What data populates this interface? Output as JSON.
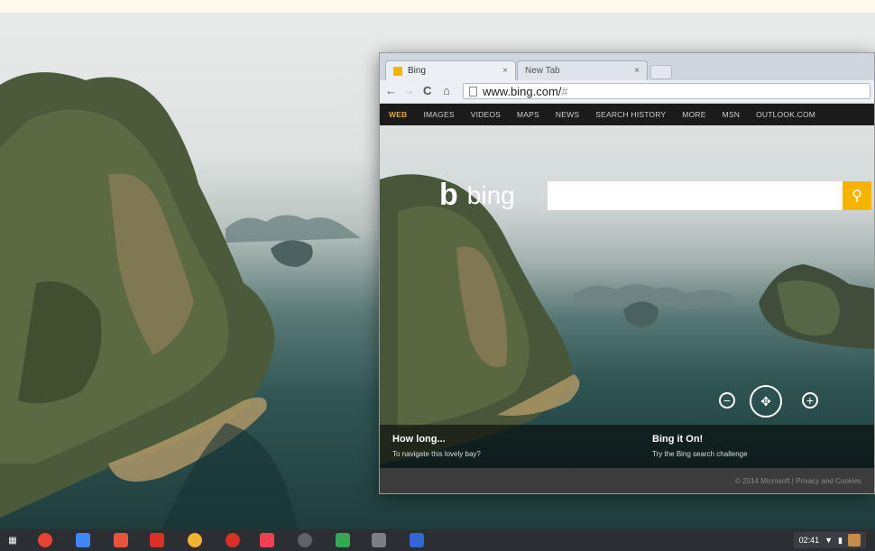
{
  "browser": {
    "tabs": [
      {
        "label": "Bing",
        "close": "×"
      },
      {
        "label": "New Tab",
        "close": "×"
      }
    ],
    "nav": {
      "back": "←",
      "forward": "→",
      "reload": "C",
      "home": "⌂"
    },
    "url": {
      "host": "www.bing.com/",
      "hash": "#"
    }
  },
  "bing": {
    "nav_items": [
      "WEB",
      "IMAGES",
      "VIDEOS",
      "MAPS",
      "NEWS",
      "SEARCH HISTORY",
      "MORE",
      "MSN",
      "OUTLOOK.COM"
    ],
    "logo_text": "bing",
    "search_placeholder": "",
    "info_left": {
      "title": "How long...",
      "subtitle": "To navigate this lovely bay?"
    },
    "info_right": {
      "title": "Bing it On!",
      "subtitle": "Try the Bing search challenge"
    },
    "footer": "© 2014 Microsoft   |   Privacy and Cookies"
  },
  "shelf": {
    "apps": [
      "app-launcher-icon",
      "chrome-icon",
      "files-icon",
      "docs-icon",
      "gmail-icon",
      "music-icon",
      "store-icon",
      "youtube-icon",
      "pocket-icon",
      "camera-icon",
      "pinwheel-icon",
      "notes-icon",
      "calc-icon"
    ],
    "time": "02:41"
  },
  "colors": {
    "bing_accent": "#f4b400",
    "nav_active": "#e7a33a",
    "shelf": "#2b2e33"
  }
}
